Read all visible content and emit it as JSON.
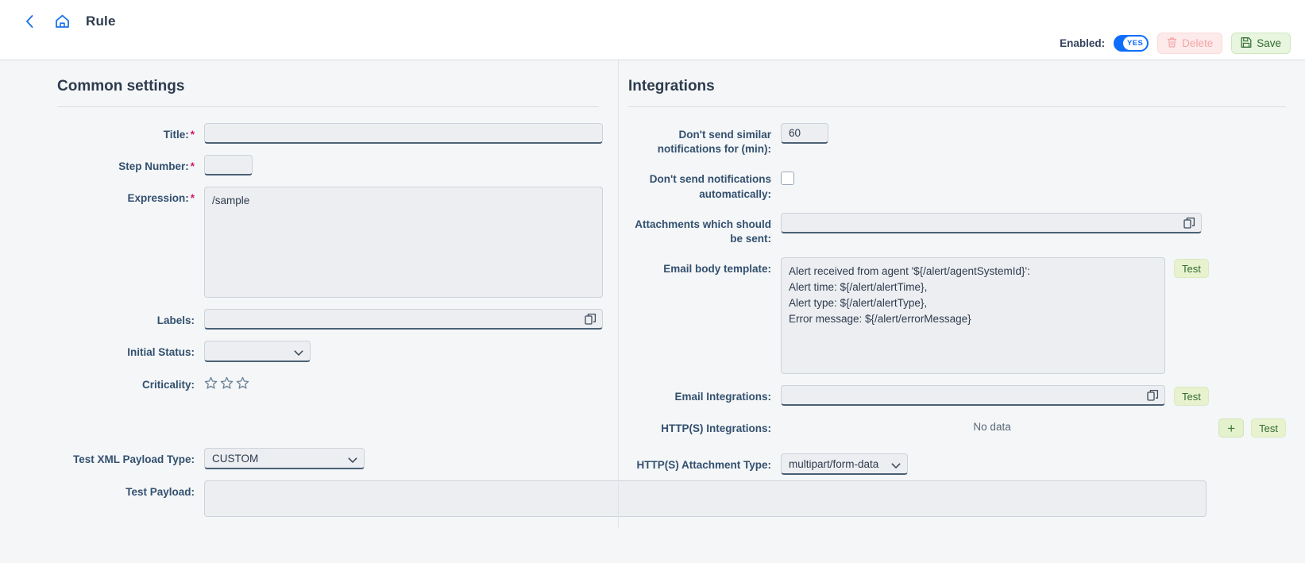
{
  "header": {
    "back_icon": "chevron-left-icon",
    "home_icon": "home-icon",
    "title": "Rule",
    "enabled_label": "Enabled:",
    "toggle_value": "YES",
    "delete_label": "Delete",
    "save_label": "Save",
    "delete_icon": "trash-icon",
    "save_icon": "floppy-disk-icon"
  },
  "common": {
    "section_title": "Common settings",
    "title_label": "Title:",
    "title_value": "",
    "step_label": "Step Number:",
    "step_value": "",
    "expression_label": "Expression:",
    "expression_value": "/sample",
    "labels_label": "Labels:",
    "labels_value": "",
    "labels_picker_icon": "picker-icon",
    "initial_status_label": "Initial Status:",
    "initial_status_value": "",
    "criticality_label": "Criticality:",
    "criticality_stars": 3,
    "criticality_filled": 0,
    "xml_type_label": "Test XML Payload Type:",
    "xml_type_value": "CUSTOM",
    "test_payload_label": "Test Payload:",
    "test_payload_value": ""
  },
  "integrations": {
    "section_title": "Integrations",
    "similar_label": "Don't send similar notifications for (min):",
    "similar_value": "60",
    "auto_label": "Don't send notifications automatically:",
    "auto_checked": false,
    "attachments_label": "Attachments which should be sent:",
    "attachments_value": "",
    "email_template_label": "Email body template:",
    "email_template_value": "Alert received from agent '${/alert/agentSystemId}':\nAlert time: ${/alert/alertTime},\nAlert type: ${/alert/alertType},\nError message: ${/alert/errorMessage}",
    "email_template_test": "Test",
    "email_int_label": "Email Integrations:",
    "email_int_value": "",
    "email_int_test": "Test",
    "http_int_label": "HTTP(S) Integrations:",
    "http_int_nodata": "No data",
    "http_int_add": "+",
    "http_int_test": "Test",
    "http_attach_label": "HTTP(S) Attachment Type:",
    "http_attach_value": "multipart/form-data"
  },
  "colors": {
    "accent_blue": "#0d6efd",
    "required_magenta": "#d6186e",
    "label_slate": "#33506e",
    "green_button": "#e8f5df",
    "pink_button": "#fdeaea",
    "page_bg": "#f4f6f8"
  }
}
